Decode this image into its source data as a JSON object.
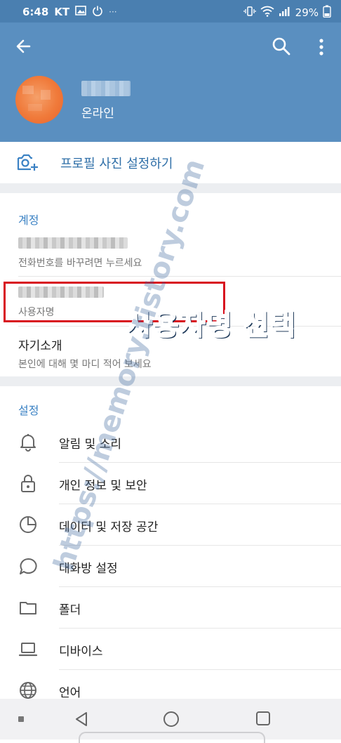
{
  "status_bar": {
    "time": "6:48",
    "carrier": "KT",
    "battery": "29%",
    "notification_dots": "···"
  },
  "profile": {
    "status": "온라인"
  },
  "set_photo": {
    "label": "프로필 사진 설정하기"
  },
  "account": {
    "title": "계정",
    "phone_sub": "전화번호를 바꾸려면 누르세요",
    "username_sub": "사용자명",
    "bio_title": "자기소개",
    "bio_sub": "본인에 대해 몇 마디 적어 보세요"
  },
  "annotation": {
    "text": "사용자명 선택"
  },
  "watermark": {
    "text": "https://memory.tistory.com"
  },
  "settings": {
    "title": "설정",
    "items": [
      {
        "label": "알림 및 소리",
        "icon": "bell-icon"
      },
      {
        "label": "개인 정보 및 보안",
        "icon": "lock-icon"
      },
      {
        "label": "데이터 및 저장 공간",
        "icon": "pie-chart-icon"
      },
      {
        "label": "대화방 설정",
        "icon": "chat-bubble-icon"
      },
      {
        "label": "폴더",
        "icon": "folder-icon"
      },
      {
        "label": "디바이스",
        "icon": "laptop-icon"
      },
      {
        "label": "언어",
        "icon": "globe-icon"
      }
    ]
  },
  "colors": {
    "header": "#5a8fc0",
    "status_bar": "#4a7fb0",
    "accent": "#3b82c4",
    "highlight": "#d8101e"
  }
}
